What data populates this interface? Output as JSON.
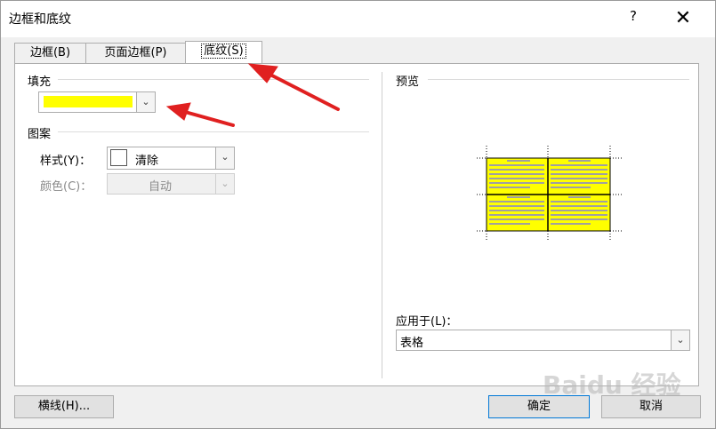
{
  "window": {
    "title": "边框和底纹",
    "help": "?",
    "close": "✕"
  },
  "tabs": [
    {
      "label": "边框(B)"
    },
    {
      "label": "页面边框(P)"
    },
    {
      "label": "底纹(S)"
    }
  ],
  "fill": {
    "group_label": "填充",
    "color": "#ffff00"
  },
  "pattern": {
    "group_label": "图案",
    "style_label": "样式(Y)：",
    "style_value": "清除",
    "color_label": "颜色(C)：",
    "color_value": "自动"
  },
  "preview": {
    "group_label": "预览",
    "fill_color": "#ffff00"
  },
  "apply": {
    "label": "应用于(L)：",
    "value": "表格"
  },
  "buttons": {
    "horizontal_line": "横线(H)...",
    "ok": "确定",
    "cancel": "取消"
  },
  "watermark": "Baidu 经验",
  "icons": {
    "dropdown": "chevron-down-icon",
    "annotation": "red-arrow"
  }
}
